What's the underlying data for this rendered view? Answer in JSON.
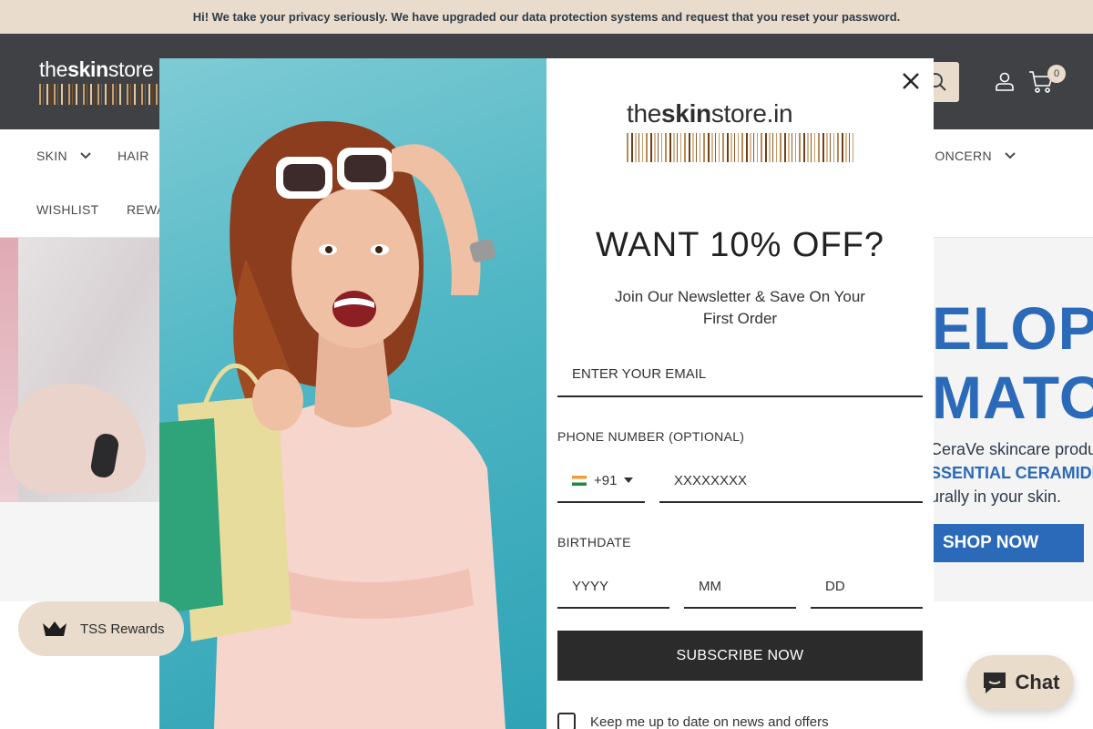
{
  "announcement": "Hi! We take your privacy seriously. We have upgraded our data protection systems and request that you reset your password.",
  "header": {
    "logo_prefix": "the",
    "logo_bold": "skin",
    "logo_suffix": "store",
    "cart_count": "0"
  },
  "nav": {
    "skin": "SKIN",
    "hair": "HAIR",
    "concern": "CONCERN",
    "wishlist": "WISHLIST",
    "rewards": "REWA"
  },
  "hero_right": {
    "line1": "ELOPE",
    "line2": "MATOL",
    "line3": "CeraVe skincare produ",
    "line4": "SSENTIAL CERAMIDE",
    "line5": "urally in your skin.",
    "cta": "SHOP NOW"
  },
  "popup": {
    "logo_prefix": "the",
    "logo_bold": "skin",
    "logo_suffix": "store.in",
    "headline": "WANT 10% OFF?",
    "subline": "Join Our Newsletter & Save On Your First Order",
    "email_placeholder": "ENTER YOUR EMAIL",
    "phone_label": "PHONE NUMBER (OPTIONAL)",
    "phone_code": "+91",
    "phone_placeholder": "XXXXXXXX",
    "birthdate_label": "BIRTHDATE",
    "year_placeholder": "YYYY",
    "month_placeholder": "MM",
    "day_placeholder": "DD",
    "subscribe_label": "SUBSCRIBE NOW",
    "consent_label": "Keep me up to date on news and offers"
  },
  "widgets": {
    "rewards_label": "TSS Rewards",
    "chat_label": "Chat"
  },
  "colors": {
    "accent": "#e9dccc",
    "header_bg": "#3f4144",
    "button_dark": "#2b2b2b",
    "promo_blue": "#2a6ab8"
  }
}
